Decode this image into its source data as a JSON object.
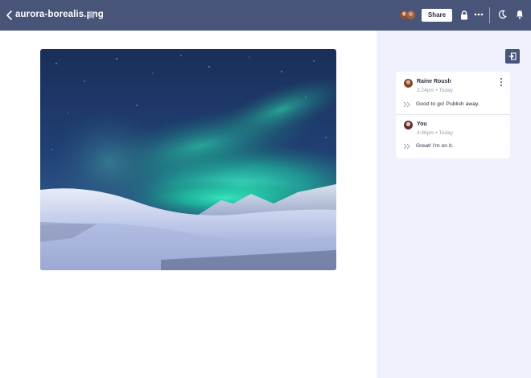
{
  "header": {
    "filename": "aurora-borealis.png",
    "share_label": "Share",
    "icons": {
      "back": "chevron-left-icon",
      "favorite": "star-icon",
      "lock": "lock-icon",
      "more": "more-horizontal-icon",
      "theme": "moon-icon",
      "notifications": "bell-icon"
    }
  },
  "colors": {
    "header_bg": "#485579",
    "panel_bg": "#eff1fc",
    "text_primary": "#2a3142",
    "text_muted": "#9aa0b2"
  },
  "canvas": {
    "image_subject": "aurora borealis over snowy landscape"
  },
  "comments": {
    "items": [
      {
        "author": "Raine Roush",
        "time": "3:24pm",
        "day": "Today",
        "text": "Good to go! Publish away."
      },
      {
        "author": "You",
        "time": "4:46pm",
        "day": "Today",
        "text": "Great! I'm on it."
      }
    ]
  }
}
